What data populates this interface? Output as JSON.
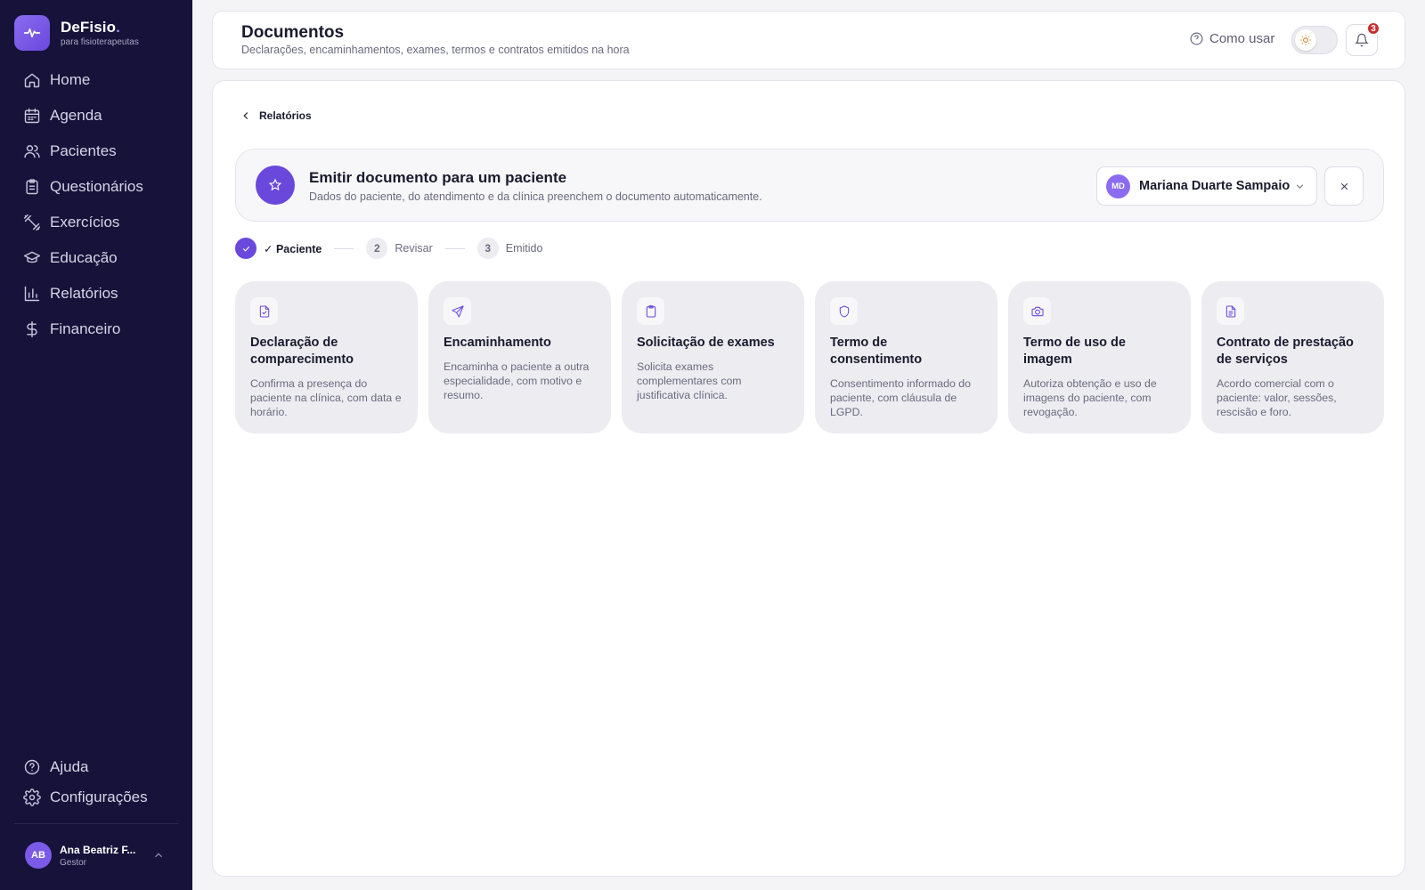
{
  "brand": {
    "name": "DeFisio",
    "dot": ".",
    "tagline": "para fisioterapeutas"
  },
  "sidebar": {
    "items": [
      {
        "label": "Home",
        "icon": "home-icon"
      },
      {
        "label": "Agenda",
        "icon": "calendar-icon"
      },
      {
        "label": "Pacientes",
        "icon": "users-icon"
      },
      {
        "label": "Questionários",
        "icon": "clipboard-icon"
      },
      {
        "label": "Exercícios",
        "icon": "dumbbell-icon"
      },
      {
        "label": "Educação",
        "icon": "graduation-cap-icon"
      },
      {
        "label": "Relatórios",
        "icon": "bar-chart-icon"
      },
      {
        "label": "Financeiro",
        "icon": "dollar-icon"
      }
    ],
    "bottom_items": [
      {
        "label": "Ajuda",
        "icon": "help-circle-icon"
      },
      {
        "label": "Configurações",
        "icon": "gear-icon"
      }
    ],
    "user": {
      "initials": "AB",
      "name": "Ana Beatriz F...",
      "role": "Gestor"
    }
  },
  "header": {
    "title": "Documentos",
    "subtitle": "Declarações, encaminhamentos, exames, termos e contratos emitidos na hora",
    "howto_label": "Como usar",
    "notification_count": "3"
  },
  "main": {
    "back_label": "Relatórios",
    "emit": {
      "title": "Emitir documento para um paciente",
      "subtitle": "Dados do paciente, do atendimento e da clínica preenchem o documento automaticamente.",
      "patient_initials": "MD",
      "patient_name": "Mariana Duarte Sampaio"
    },
    "steps": [
      {
        "number": "",
        "label": "✓ Paciente",
        "state": "done"
      },
      {
        "number": "2",
        "label": "Revisar",
        "state": "todo"
      },
      {
        "number": "3",
        "label": "Emitido",
        "state": "todo"
      }
    ],
    "documents": [
      {
        "title": "Declaração de comparecimento",
        "description": "Confirma a presença do paciente na clínica, com data e horário.",
        "icon": "file-check-icon"
      },
      {
        "title": "Encaminhamento",
        "description": "Encaminha o paciente a outra especialidade, com motivo e resumo.",
        "icon": "send-icon"
      },
      {
        "title": "Solicitação de exames",
        "description": "Solicita exames complementares com justificativa clínica.",
        "icon": "clipboard-icon"
      },
      {
        "title": "Termo de consentimento",
        "description": "Consentimento informado do paciente, com cláusula de LGPD.",
        "icon": "shield-icon"
      },
      {
        "title": "Termo de uso de imagem",
        "description": "Autoriza obtenção e uso de imagens do paciente, com revogação.",
        "icon": "camera-icon"
      },
      {
        "title": "Contrato de prestação de serviços",
        "description": "Acordo comercial com o paciente: valor, sessões, rescisão e foro.",
        "icon": "file-text-icon"
      }
    ]
  },
  "colors": {
    "sidebar_bg": "#16123a",
    "accent": "#6a48dc",
    "badge": "#c62f2f"
  }
}
